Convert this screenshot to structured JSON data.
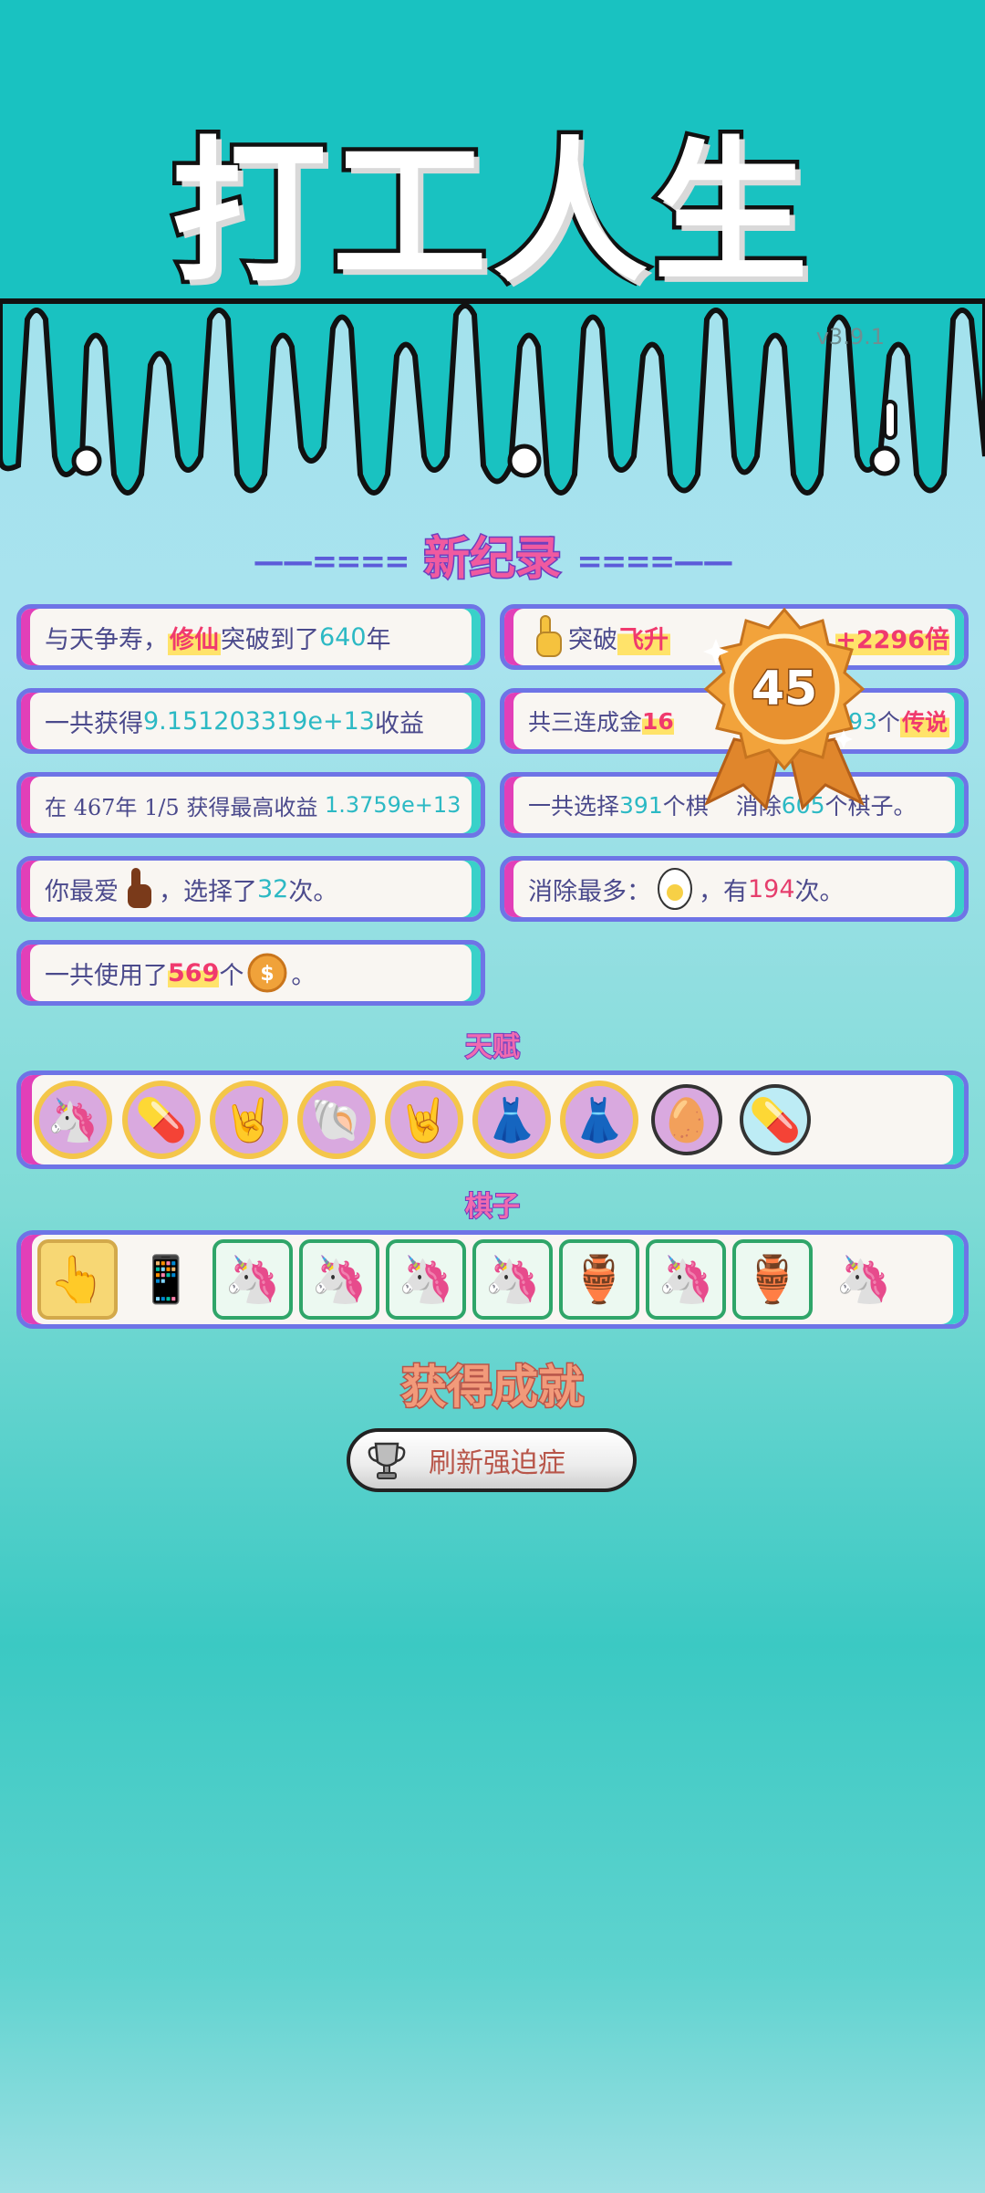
{
  "app": {
    "title": "打工人生",
    "version": "v3.9.1"
  },
  "records": {
    "heading": "新纪录",
    "heading_left": "——====",
    "heading_right": "====——",
    "left": [
      {
        "pre": "与天争寿，",
        "hl": "修仙",
        "mid": "突破到了",
        "num": "640",
        "post": "年"
      },
      {
        "pre": "一共获得",
        "num": "9.151203319e+13",
        "post": "收益"
      },
      {
        "pre": "在 467年 1/5 获得最高收益",
        "num": "1.3759e+13"
      },
      {
        "pre": "你最爱",
        "mid": "，选择了",
        "num": "32",
        "post": "次。"
      },
      {
        "pre": "一共使用了",
        "hlnum": "569",
        "mid": "个",
        "post": "。"
      }
    ],
    "right": [
      {
        "mid": "突破",
        "hl": "飞升",
        "post_hlnum": "+2296倍"
      },
      {
        "pre": "共三连成金",
        "hlnum": "16",
        "num": "93",
        "mid": "个",
        "hl": "传说"
      },
      {
        "pre": "一共选择",
        "num": "391",
        "mid": "个棋",
        "mid2": "消除",
        "num2": "605",
        "post": "个棋子。"
      },
      {
        "pre": "消除最多：",
        "mid": "，有",
        "red": "194",
        "post": "次。"
      }
    ],
    "medal_level": "45"
  },
  "talents": {
    "heading": "天赋",
    "items": [
      "unicorn-icon",
      "pill-icon",
      "rock-hand-icon",
      "shell-icon",
      "rock-hand-icon",
      "skirt-icon",
      "skirt-icon",
      "egg-icon",
      "pill-pack-icon"
    ]
  },
  "pieces": {
    "heading": "棋子",
    "items": [
      "hand-pointer-icon",
      "phone-icon",
      "unicorn-icon",
      "unicorn-icon",
      "unicorn-icon",
      "unicorn-icon",
      "vase-icon",
      "unicorn-icon",
      "vase-icon",
      "unicorn-icon"
    ]
  },
  "achievements": {
    "heading": "获得成就",
    "button_label": "刷新强迫症"
  },
  "colors": {
    "card_border": "#6e74e6",
    "card_left": "#e23fb8",
    "card_right": "#39d1c9",
    "num": "#2cb9c4",
    "highlight": "#f03a6e"
  }
}
